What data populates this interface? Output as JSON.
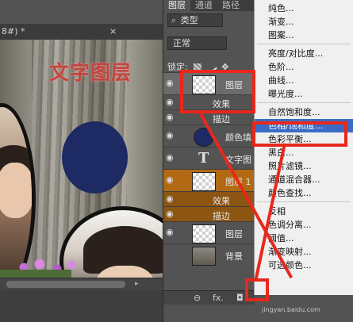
{
  "document": {
    "tab_title": "8#) *",
    "tab_close": "×",
    "canvas_text": "文字图层"
  },
  "layers_panel": {
    "tabs": [
      "图层",
      "通道",
      "路径"
    ],
    "filter_label": "类型",
    "blend_mode": "正常",
    "lock_label": "锁定:",
    "layers": [
      {
        "kind": "layer",
        "name": "图层",
        "thumb": "checker",
        "selected": true
      },
      {
        "kind": "sub",
        "name": "效果"
      },
      {
        "kind": "sub",
        "name": "描边"
      },
      {
        "kind": "layer",
        "name": "颜色填",
        "thumb": "blue"
      },
      {
        "kind": "layer",
        "name": "文字图",
        "thumb": "text"
      },
      {
        "kind": "layer",
        "name": "图层 1",
        "thumb": "checker",
        "orange": true
      },
      {
        "kind": "sub",
        "name": "效果",
        "orange": true
      },
      {
        "kind": "sub",
        "name": "描边",
        "orange": true
      },
      {
        "kind": "layer",
        "name": "图层",
        "thumb": "checker"
      },
      {
        "kind": "layer",
        "name": "背景",
        "thumb": "photo"
      }
    ],
    "bottom_icons": [
      "link-icon",
      "fx-icon",
      "mask-icon",
      "adjustment-icon"
    ],
    "fx_label": "fx.",
    "link_glyph": "⊖",
    "mask_glyph": "◘"
  },
  "adjustment_menu": {
    "items": [
      {
        "label": "纯色..."
      },
      {
        "label": "渐变..."
      },
      {
        "label": "图案..."
      },
      {
        "sep": true
      },
      {
        "label": "亮度/对比度..."
      },
      {
        "label": "色阶..."
      },
      {
        "label": "曲线..."
      },
      {
        "label": "曝光度..."
      },
      {
        "sep": true
      },
      {
        "label": "自然饱和度..."
      },
      {
        "label": "色相/饱和度...",
        "highlighted": true
      },
      {
        "label": "色彩平衡..."
      },
      {
        "label": "黑白..."
      },
      {
        "label": "照片滤镜..."
      },
      {
        "label": "通道混合器..."
      },
      {
        "label": "颜色查找..."
      },
      {
        "sep": true
      },
      {
        "label": "反相"
      },
      {
        "label": "色调分离..."
      },
      {
        "label": "阈值..."
      },
      {
        "label": "渐变映射..."
      },
      {
        "label": "可选颜色..."
      }
    ]
  },
  "watermark": "jingyan.baidu.com",
  "colors": {
    "annotation_red": "#e8281c",
    "menu_highlight": "#3b6bc4",
    "layer_orange": "#b26914",
    "fill_blue": "#1e2a63"
  }
}
